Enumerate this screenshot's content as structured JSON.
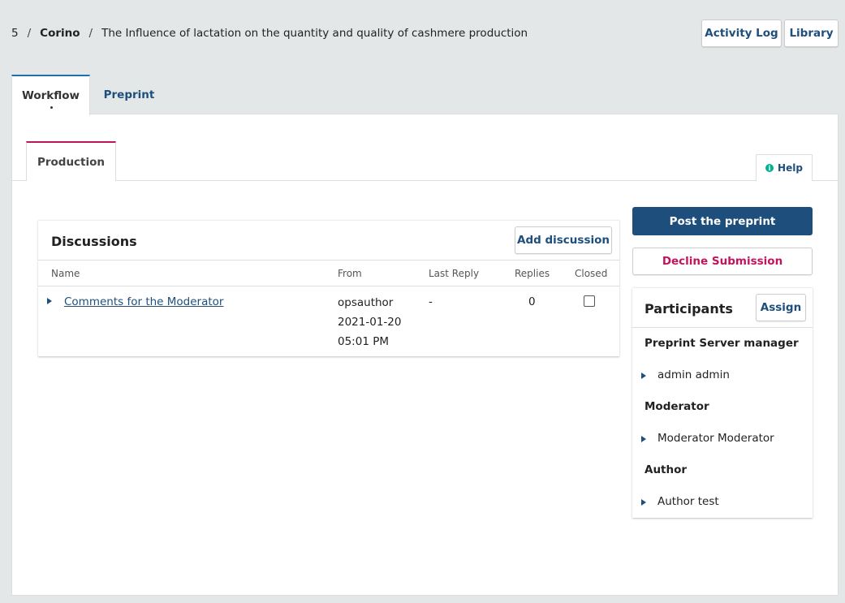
{
  "breadcrumb": {
    "id": "5",
    "author": "Corino",
    "title": "The Influence of lactation on the quantity and quality of cashmere production"
  },
  "header_buttons": {
    "activity_log": "Activity Log",
    "library": "Library"
  },
  "tabs": [
    {
      "label": "Workflow",
      "active": true
    },
    {
      "label": "Preprint",
      "active": false
    }
  ],
  "stage_tab": {
    "label": "Production"
  },
  "help": {
    "label": "Help"
  },
  "discussions": {
    "title": "Discussions",
    "add_label": "Add discussion",
    "columns": {
      "name": "Name",
      "from": "From",
      "last_reply": "Last Reply",
      "replies": "Replies",
      "closed": "Closed"
    },
    "rows": [
      {
        "name": "Comments for the Moderator",
        "from_user": "opsauthor",
        "from_date": "2021-01-20",
        "from_time": "05:01 PM",
        "last_reply": "-",
        "replies": "0",
        "closed": false
      }
    ]
  },
  "actions": {
    "post": "Post the preprint",
    "decline": "Decline Submission"
  },
  "participants": {
    "title": "Participants",
    "assign_label": "Assign",
    "groups": [
      {
        "role": "Preprint Server manager",
        "members": [
          "admin admin"
        ]
      },
      {
        "role": "Moderator",
        "members": [
          "Moderator Moderator"
        ]
      },
      {
        "role": "Author",
        "members": [
          "Author test"
        ]
      }
    ]
  },
  "colors": {
    "primary": "#1e4f7c",
    "accent_pink": "#c0145d",
    "workflow_tab_border": "#1e6fb0",
    "help_icon": "#00b28f",
    "background": "#e4e7e8"
  }
}
